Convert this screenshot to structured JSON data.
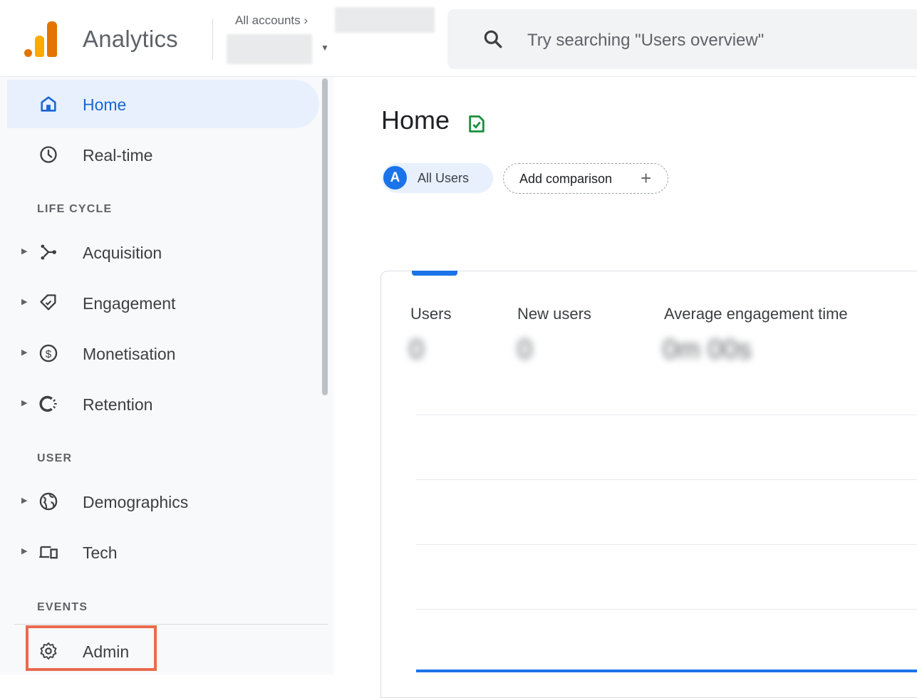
{
  "header": {
    "app_title": "Analytics",
    "breadcrumb": "All accounts ›",
    "search_placeholder": "Try searching \"Users overview\""
  },
  "sidebar": {
    "top_items": [
      {
        "label": "Home",
        "icon": "home-icon",
        "active": true
      },
      {
        "label": "Real-time",
        "icon": "clock-icon",
        "active": false
      }
    ],
    "sections": {
      "lifecycle": "LIFE CYCLE",
      "user": "USER",
      "events": "EVENTS"
    },
    "lifecycle_items": [
      {
        "label": "Acquisition",
        "icon": "acquisition-icon"
      },
      {
        "label": "Engagement",
        "icon": "engagement-icon"
      },
      {
        "label": "Monetisation",
        "icon": "monetisation-icon"
      },
      {
        "label": "Retention",
        "icon": "retention-icon"
      }
    ],
    "user_items": [
      {
        "label": "Demographics",
        "icon": "globe-icon"
      },
      {
        "label": "Tech",
        "icon": "devices-icon"
      }
    ],
    "admin_label": "Admin"
  },
  "main": {
    "page_title": "Home",
    "segment_chip": {
      "avatar": "A",
      "label": "All Users"
    },
    "compare_label": "Add comparison",
    "compare_plus": "+",
    "metrics": [
      {
        "label": "Users",
        "value": "0"
      },
      {
        "label": "New users",
        "value": "0"
      },
      {
        "label": "Average engagement time",
        "value": "0m 00s"
      }
    ]
  },
  "colors": {
    "brand_orange": "#e37400",
    "brand_yellow": "#f9ab00",
    "accent_blue": "#1a73e8",
    "active_bg": "#e8f0fe",
    "highlight_box": "#ea6b4f"
  }
}
